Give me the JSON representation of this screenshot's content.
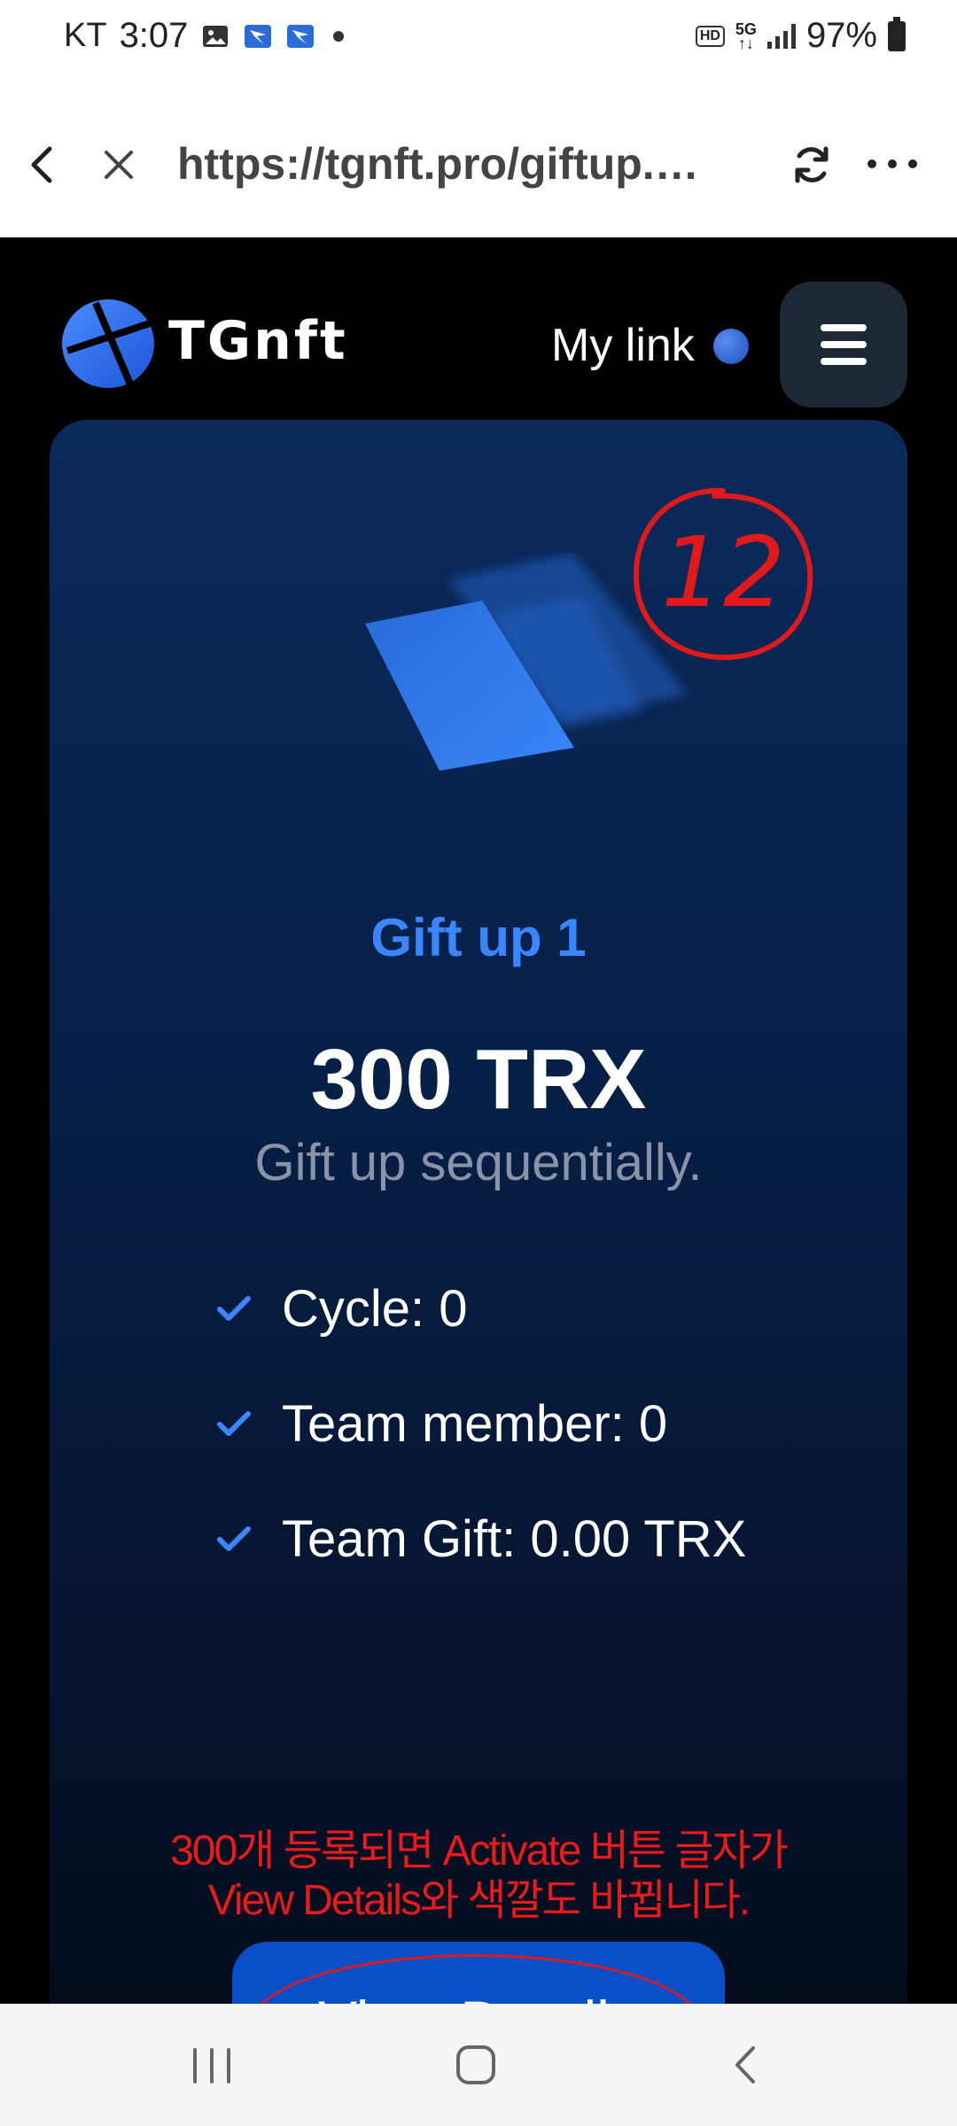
{
  "status_bar": {
    "carrier": "KT",
    "time": "3:07",
    "network": "5G",
    "hd_badge": "HD",
    "battery": "97%"
  },
  "browser": {
    "url": "https://tgnft.pro/giftup.…",
    "icons": [
      "back-arrow-icon",
      "close-icon",
      "refresh-icon",
      "more-icon"
    ]
  },
  "header": {
    "logo_text": "TGnft",
    "my_link_label": "My link",
    "menu_icon": "hamburger-menu-icon"
  },
  "card": {
    "annotation_number": "12",
    "title": "Gift up 1",
    "amount": "300 TRX",
    "subtitle": "Gift up sequentially.",
    "features": [
      {
        "label": "Cycle: 0"
      },
      {
        "label": "Team member: 0"
      },
      {
        "label": "Team Gift: 0.00 TRX"
      }
    ],
    "note_line1": "300개 등록되면 Activate 버튼 글자가",
    "note_line2": "View Details와 색깔도 바뀝니다.",
    "button_label": "View Details",
    "colors": {
      "accent": "#3a86ff",
      "button": "#0b4fc9",
      "annotation": "#e01a1a"
    }
  },
  "navbar": {
    "icons": [
      "recent-apps-icon",
      "home-icon",
      "back-icon"
    ]
  }
}
